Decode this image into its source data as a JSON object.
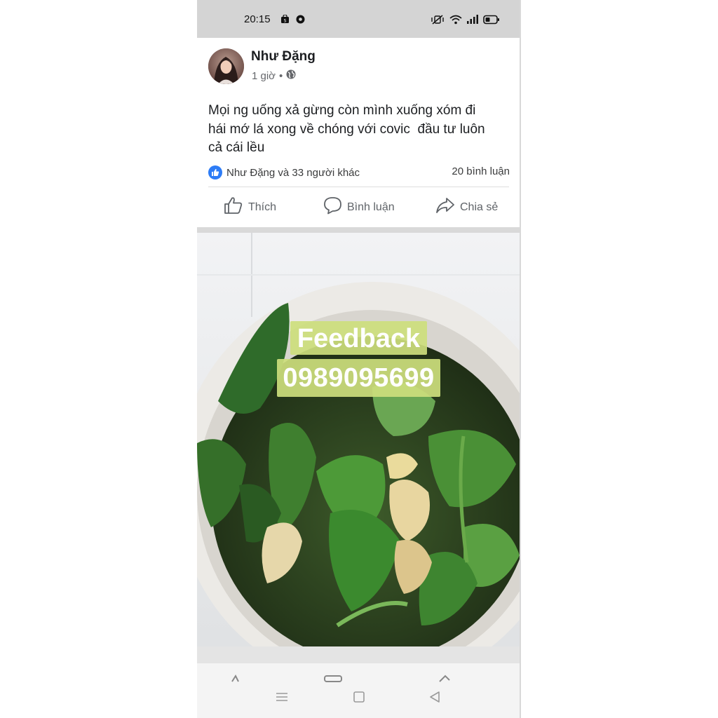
{
  "status_bar": {
    "time": "20:15",
    "icons": [
      "shop-notification-icon",
      "chrome-icon",
      "mute-icon",
      "wifi-icon",
      "signal-icon",
      "battery-icon"
    ]
  },
  "post": {
    "author": "Như Đặng",
    "time_ago": "1 giờ",
    "meta_separator": "•",
    "privacy_icon": "globe-icon",
    "text": "Mọi ng uống xả gừng còn mình xuống xóm đi\nhái mớ lá xong về chóng với covic  đầu tư luôn\ncả cái lều",
    "reactions_text": "Như Đặng và 33 người khác",
    "comments_count": "20 bình luận"
  },
  "actions": {
    "like_label": "Thích",
    "comment_label": "Bình luận",
    "share_label": "Chia sẻ"
  },
  "photo": {
    "overlay_line1": "Feedback",
    "overlay_line2": "0989095699"
  },
  "nav": {
    "buttons": [
      "menu-icon",
      "home-square-icon",
      "back-triangle-icon"
    ]
  },
  "colors": {
    "status_bar_bg": "#d4d4d4",
    "like_blue": "#2d7cf6",
    "overlay_green": "#cdde7d"
  }
}
